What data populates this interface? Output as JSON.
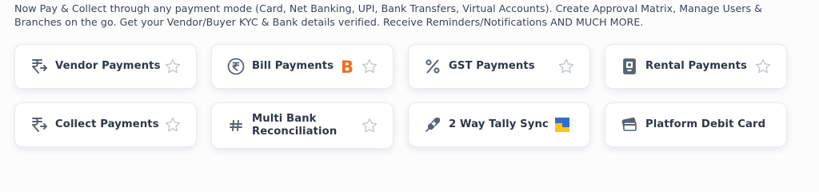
{
  "intro": {
    "line1": "Now Pay & Collect through any payment mode (Card, Net Banking, UPI, Bank Transfers, Virtual Accounts). Create Approval Matrix, Manage Users &",
    "line2": "Branches on the go. Get your Vendor/Buyer KYC & Bank details verified. Receive Reminders/Notifications AND MUCH MORE."
  },
  "cards": [
    {
      "label": "Vendor Payments",
      "icon": "rupee-arrows-icon"
    },
    {
      "label": "Bill Payments",
      "icon": "rupee-circle-icon",
      "brand": "B"
    },
    {
      "label": "GST Payments",
      "icon": "percent-icon"
    },
    {
      "label": "Rental Payments",
      "icon": "rental-document-icon"
    },
    {
      "label": "Collect Payments",
      "icon": "rupee-arrows-icon"
    },
    {
      "label": "Multi Bank Reconciliation",
      "icon": "hash-icon"
    },
    {
      "label": "2 Way Tally Sync",
      "icon": "plug-icon"
    },
    {
      "label": "Platform Debit Card",
      "icon": "debit-card-icon"
    }
  ],
  "colors": {
    "card_border": "#e8eaef",
    "text": "#2e3748",
    "icon": "#5a6372",
    "star": "#c4c8d0",
    "brand_orange": "#f26b1d",
    "tally_blue": "#2d6fd1",
    "tally_yellow": "#f5c518"
  }
}
